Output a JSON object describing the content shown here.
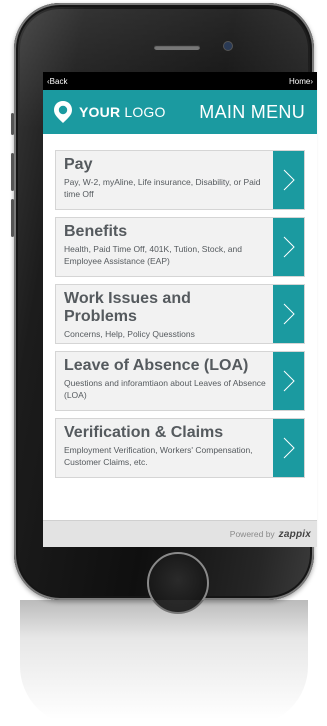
{
  "nav": {
    "back": "‹Back",
    "home": "Home›"
  },
  "header": {
    "logo_bold": "YOUR",
    "logo_light": " LOGO",
    "title": "MAIN MENU"
  },
  "menu": {
    "items": [
      {
        "title": "Pay",
        "desc": "Pay, W-2, myAline, Life insurance, Disability, or Paid time Off"
      },
      {
        "title": "Benefits",
        "desc": "Health, Paid Time Off, 401K, Tution, Stock, and Employee Assistance (EAP)"
      },
      {
        "title": "Work Issues and Problems",
        "desc": "Concerns, Help, Policy Quesstions"
      },
      {
        "title": "Leave of Absence (LOA)",
        "desc": "Questions and inforamtiaon about Leaves of Absence (LOA)"
      },
      {
        "title": "Verification & Claims",
        "desc": "Employment Verification, Workers' Compensation, Customer Claims, etc."
      }
    ]
  },
  "footer": {
    "powered_by": "Powered by",
    "brand": "zappix"
  },
  "colors": {
    "accent": "#1b9aa0",
    "text": "#555a5e",
    "footer_bg": "#e3e3e3"
  },
  "icons": {
    "logo": "location-pin-icon",
    "arrow": "chevron-right-icon"
  }
}
